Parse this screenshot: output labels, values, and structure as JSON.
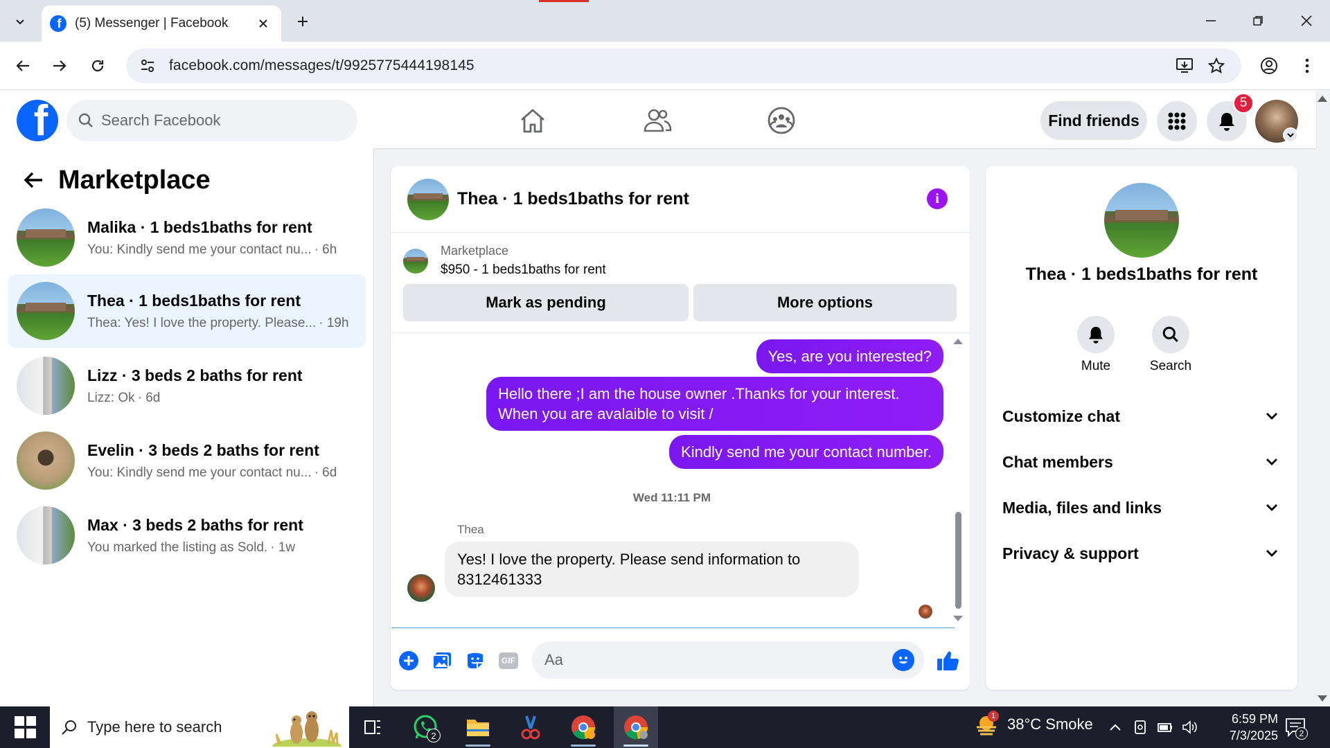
{
  "browser": {
    "tab_title": "(5) Messenger | Facebook",
    "url": "facebook.com/messages/t/9925775444198145"
  },
  "header": {
    "search_placeholder": "Search Facebook",
    "find_friends": "Find friends",
    "notification_count": "5",
    "brand_color": "#0866ff"
  },
  "sidebar": {
    "title": "Marketplace",
    "conversations": [
      {
        "name": "Malika · 1 beds1baths for rent",
        "snippet": "You: Kindly send me your contact nu...",
        "time": "· 6h"
      },
      {
        "name": "Thea · 1 beds1baths for rent",
        "snippet": "Thea: Yes! I love the property. Please...",
        "time": "· 19h"
      },
      {
        "name": "Lizz · 3 beds 2 baths for rent",
        "snippet": "Lizz: Ok",
        "time": "· 6d"
      },
      {
        "name": "Evelin · 3 beds 2 baths for rent",
        "snippet": "You: Kindly send me your contact nu...",
        "time": "· 6d"
      },
      {
        "name": "Max · 3 beds 2 baths for rent",
        "snippet": "You marked the listing as Sold.",
        "time": "· 1w"
      }
    ]
  },
  "chat": {
    "title": "Thea · 1 beds1baths for rent",
    "listing_label": "Marketplace",
    "listing_price": "$950 - 1 beds1baths for rent",
    "mark_pending": "Mark as pending",
    "more_options": "More options",
    "outgoing": [
      "Yes, are you interested?",
      "Hello there ;I am the house owner .Thanks for your interest.",
      "When you are avalaible to visit /",
      "Kindly send me your contact number."
    ],
    "timestamp": "Wed 11:11 PM",
    "sender": "Thea",
    "incoming": [
      "Yes! I love the property. Please send information to",
      "8312461333"
    ],
    "input_placeholder": "Aa",
    "gif_label": "GIF",
    "accent_color": "#8a1cf4"
  },
  "details": {
    "name": "Thea · 1 beds1baths for rent",
    "mute": "Mute",
    "search": "Search",
    "sections": [
      "Customize chat",
      "Chat members",
      "Media, files and links",
      "Privacy & support"
    ]
  },
  "taskbar": {
    "search_placeholder": "Type here to search",
    "whatsapp_count": "2",
    "weather_badge": "1",
    "weather": "38°C  Smoke",
    "time": "6:59 PM",
    "date": "7/3/2025",
    "notif_count": "2"
  }
}
